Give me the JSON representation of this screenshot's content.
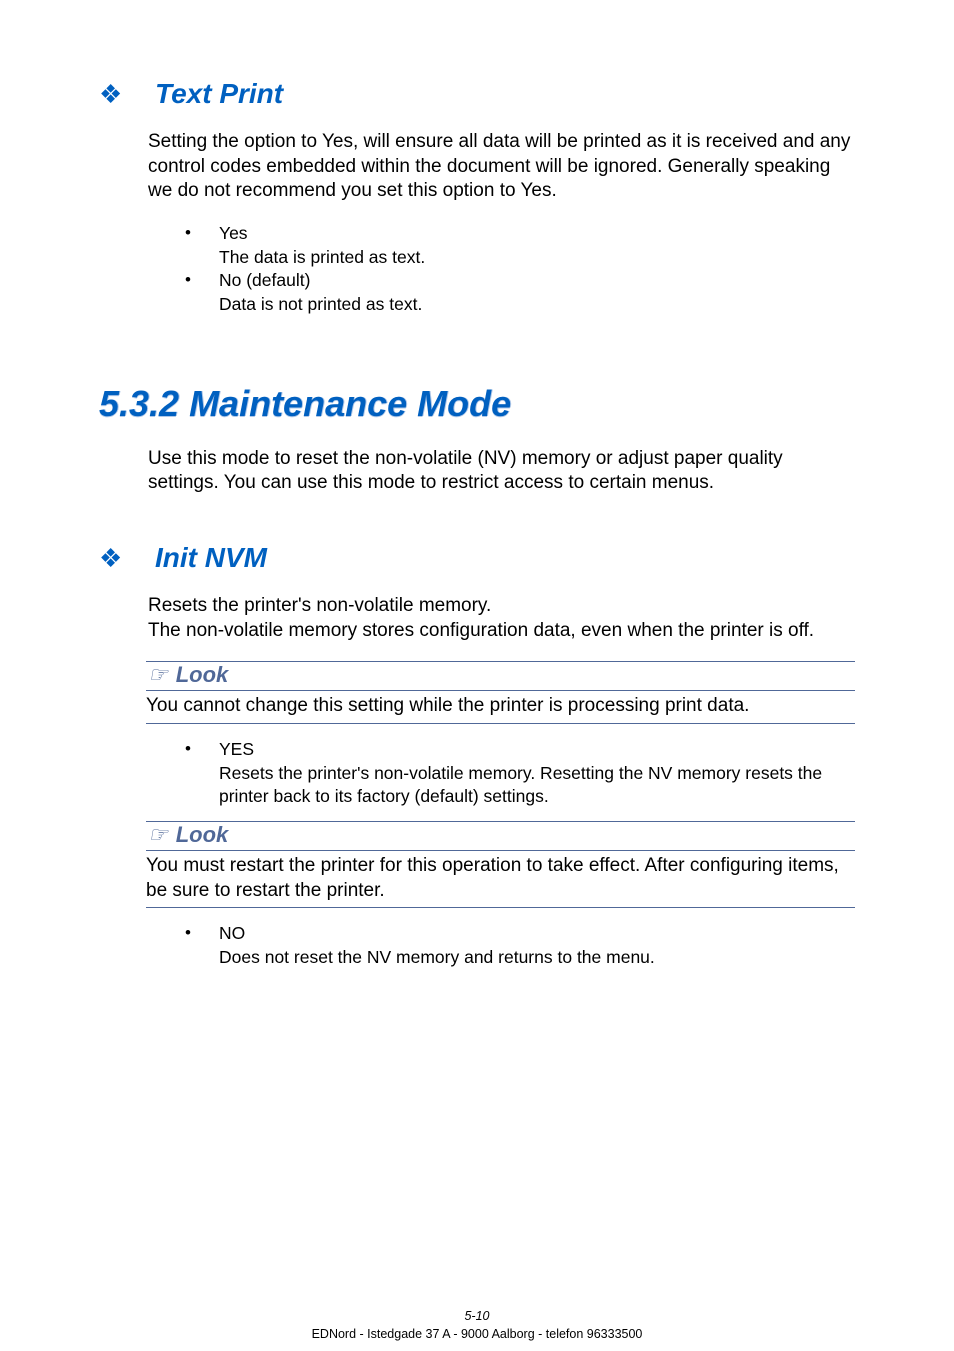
{
  "sections": {
    "textPrint": {
      "bullet": "❖",
      "title": "Text Print",
      "paragraph": "Setting the option to Yes, will ensure all data will be printed as it is received and any control codes embedded within the document will be ignored. Generally speaking we do not recommend you set this option to Yes.",
      "options": [
        {
          "label": "Yes",
          "desc": "The data is printed as text."
        },
        {
          "label": "No (default)",
          "desc": "Data is not printed as text."
        }
      ]
    },
    "maintHeading": "5.3.2   Maintenance Mode",
    "maintParagraph": "Use this mode to reset the non-volatile (NV) memory or adjust paper quality settings. You can use this mode to restrict access to certain menus.",
    "initNVM": {
      "bullet": "❖",
      "title": "Init NVM",
      "paragraph": "Resets the printer's non-volatile memory.\nThe non-volatile memory stores configuration data, even when the printer is off.",
      "look1": {
        "icon": "☞",
        "label": "Look",
        "body": "You cannot change this setting while the printer is processing print data."
      },
      "opt1": {
        "label": "YES",
        "desc": "Resets the printer's non-volatile memory. Resetting the NV memory resets the printer back to its factory (default) settings."
      },
      "look2": {
        "icon": "☞",
        "label": "Look",
        "body": "You must restart the printer for this operation to take effect. After configuring items, be sure to restart the printer."
      },
      "opt2": {
        "label": "NO",
        "desc": "Does not reset the NV memory and returns to the menu."
      }
    }
  },
  "footer": {
    "pagenum": "5-10",
    "line2": "EDNord - Istedgade 37 A - 9000 Aalborg - telefon 96333500"
  }
}
